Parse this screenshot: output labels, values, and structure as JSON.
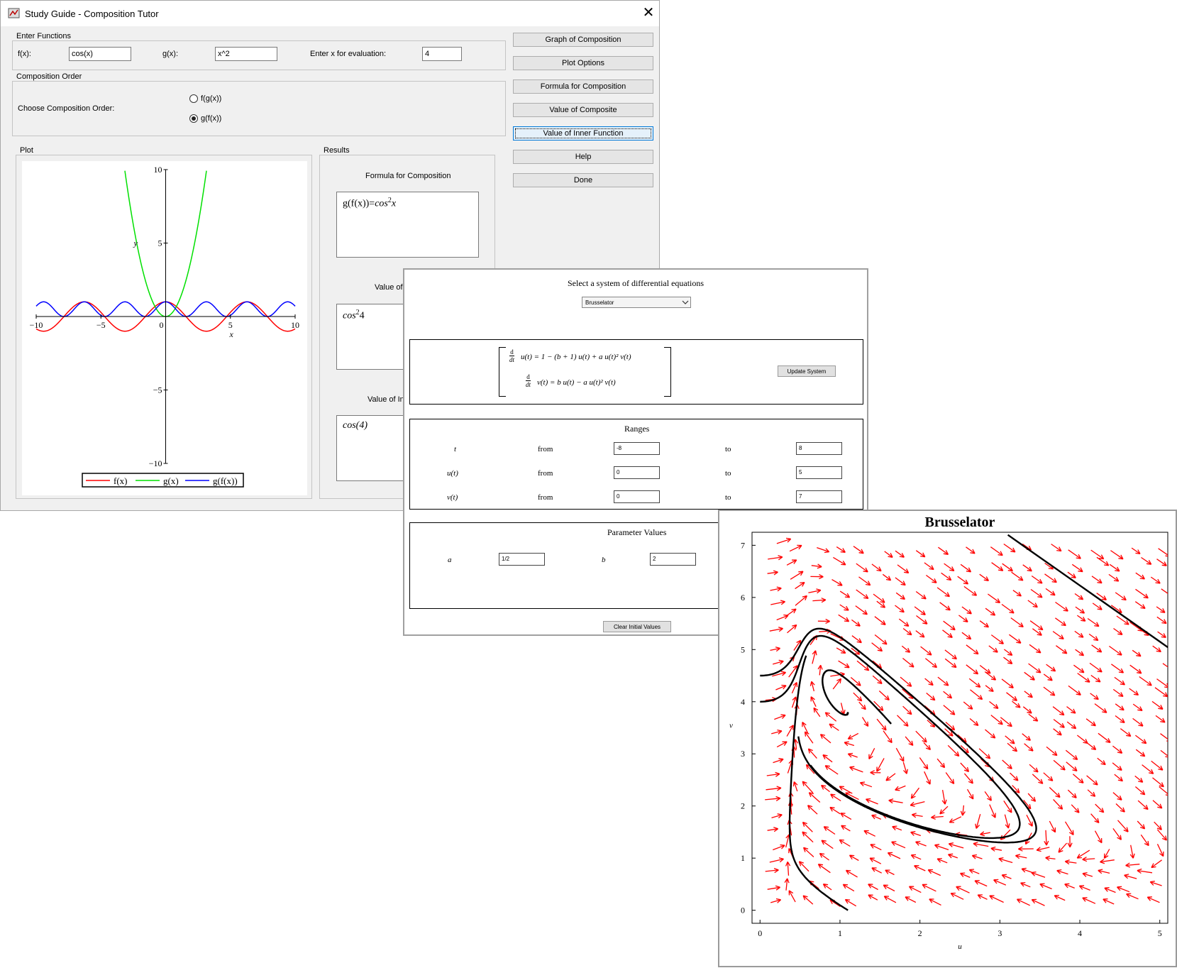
{
  "window1": {
    "title": "Study Guide - Composition Tutor",
    "close_glyph": "✕",
    "enter_functions": {
      "legend": "Enter Functions",
      "fx_label": "f(x):",
      "fx_value": "cos(x)",
      "gx_label": "g(x):",
      "gx_value": "x^2",
      "xeval_label": "Enter x for evaluation:",
      "xeval_value": "4"
    },
    "composition_order": {
      "legend": "Composition Order",
      "label": "Choose Composition Order:",
      "option1": "f(g(x))",
      "option2": "g(f(x))",
      "selected": "g(f(x))"
    },
    "buttons": [
      "Graph of Composition",
      "Plot Options",
      "Formula for Composition",
      "Value of Composite",
      "Value of Inner Function",
      "Help",
      "Done"
    ],
    "plot": {
      "legend": "Plot",
      "chart_data": {
        "type": "line",
        "xlim": [
          -10,
          10
        ],
        "ylim": [
          -10,
          10
        ],
        "xlabel": "x",
        "ylabel": "y",
        "xticks": [
          "−10",
          "−5",
          "0",
          "5",
          "10"
        ],
        "yticks": [
          "10",
          "5",
          "−5",
          "−10"
        ],
        "series": [
          {
            "name": "f(x)",
            "expr": "cos(x)",
            "color": "#ff0000"
          },
          {
            "name": "g(x)",
            "expr": "x^2",
            "color": "#00e000"
          },
          {
            "name": "g(f(x))",
            "expr": "cos(x)^2",
            "color": "#0000ff"
          }
        ]
      }
    },
    "results": {
      "legend": "Results",
      "formula_label": "Formula for Composition",
      "formula_value_lhs": "g(f(x))=",
      "formula_value_rhs": "cos",
      "formula_sup": "2",
      "formula_tail": "x",
      "value_composite_label": "Value of",
      "value_composite_base": "cos",
      "value_composite_sup": "2",
      "value_composite_tail": "4",
      "value_inner_label": "Value of In",
      "value_inner_value": "cos(4)"
    }
  },
  "window2": {
    "heading": "Select a system of differential equations",
    "system_select": "Brusselator",
    "eq1": "u(t) = 1 − (b + 1) u(t) + a u(t)² v(t)",
    "eq2": "v(t) = b u(t) − a u(t)² v(t)",
    "d_label": "d",
    "dt_label": "dt",
    "update_button": "Update System",
    "ranges": {
      "title": "Ranges",
      "from": "from",
      "to": "to",
      "rows": [
        {
          "var": "t",
          "from": "-8",
          "to": "8"
        },
        {
          "var": "u(t)",
          "from": "0",
          "to": "5"
        },
        {
          "var": "v(t)",
          "from": "0",
          "to": "7"
        }
      ]
    },
    "params": {
      "title": "Parameter Values",
      "a_label": "a",
      "a_value": "1/2",
      "b_label": "b",
      "b_value": "2"
    },
    "clear_button": "Clear Initial Values"
  },
  "window3": {
    "chart_data": {
      "type": "line",
      "title": "Brusselator",
      "xlabel": "u",
      "ylabel": "v",
      "xlim": [
        -0.1,
        5.1
      ],
      "ylim": [
        -0.25,
        7.25
      ],
      "xticks": [
        0,
        1,
        2,
        3,
        4,
        5
      ],
      "yticks": [
        0,
        1,
        2,
        3,
        4,
        5,
        6,
        7
      ],
      "params": {
        "a": 0.5,
        "b": 2
      },
      "field_color": "#ff0000",
      "trajectory_color": "#000000"
    }
  }
}
